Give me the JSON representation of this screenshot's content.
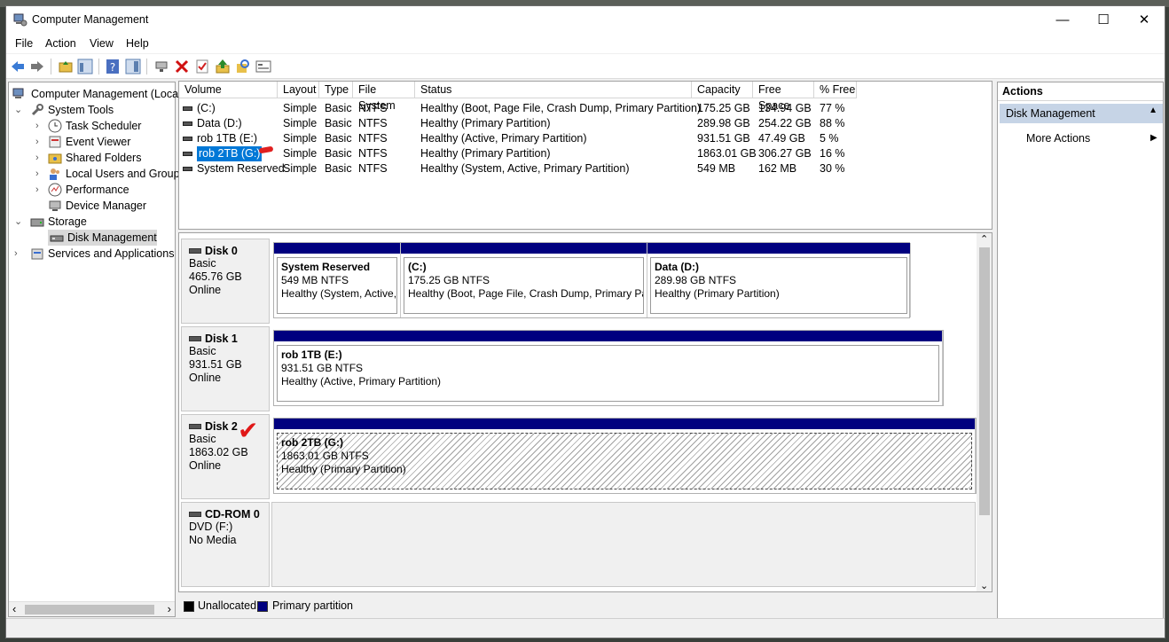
{
  "window": {
    "title": "Computer Management",
    "minimize": "—",
    "maximize": "☐",
    "close": "✕"
  },
  "menu": [
    "File",
    "Action",
    "View",
    "Help"
  ],
  "tree": {
    "root": "Computer Management (Local",
    "system_tools": "System Tools",
    "task_scheduler": "Task Scheduler",
    "event_viewer": "Event Viewer",
    "shared_folders": "Shared Folders",
    "local_users": "Local Users and Groups",
    "performance": "Performance",
    "device_manager": "Device Manager",
    "storage": "Storage",
    "disk_management": "Disk Management",
    "services": "Services and Applications"
  },
  "volume_table": {
    "headers": [
      "Volume",
      "Layout",
      "Type",
      "File System",
      "Status",
      "Capacity",
      "Free Space",
      "% Free"
    ],
    "rows": [
      [
        "(C:)",
        "Simple",
        "Basic",
        "NTFS",
        "Healthy (Boot, Page File, Crash Dump, Primary Partition)",
        "175.25 GB",
        "134.94 GB",
        "77 %"
      ],
      [
        "Data (D:)",
        "Simple",
        "Basic",
        "NTFS",
        "Healthy (Primary Partition)",
        "289.98 GB",
        "254.22 GB",
        "88 %"
      ],
      [
        "rob 1TB (E:)",
        "Simple",
        "Basic",
        "NTFS",
        "Healthy (Active, Primary Partition)",
        "931.51 GB",
        "47.49 GB",
        "5 %"
      ],
      [
        "rob 2TB (G:)",
        "Simple",
        "Basic",
        "NTFS",
        "Healthy (Primary Partition)",
        "1863.01 GB",
        "306.27 GB",
        "16 %"
      ],
      [
        "System Reserved",
        "Simple",
        "Basic",
        "NTFS",
        "Healthy (System, Active, Primary Partition)",
        "549 MB",
        "162 MB",
        "30 %"
      ]
    ],
    "selected_row": 3
  },
  "disks": [
    {
      "name": "Disk 0",
      "type": "Basic",
      "size": "465.76 GB",
      "state": "Online",
      "partitions": [
        {
          "name": "System Reserved",
          "size": "549 MB NTFS",
          "status": "Healthy (System, Active, Primary Partition)"
        },
        {
          "name": " (C:)",
          "size": "175.25 GB NTFS",
          "status": "Healthy (Boot, Page File, Crash Dump, Primary Partition)"
        },
        {
          "name": "Data  (D:)",
          "size": "289.98 GB NTFS",
          "status": "Healthy (Primary Partition)"
        }
      ]
    },
    {
      "name": "Disk 1",
      "type": "Basic",
      "size": "931.51 GB",
      "state": "Online",
      "partitions": [
        {
          "name": "rob 1TB  (E:)",
          "size": "931.51 GB NTFS",
          "status": "Healthy (Active, Primary Partition)"
        }
      ]
    },
    {
      "name": "Disk 2",
      "type": "Basic",
      "size": "1863.02 GB",
      "state": "Online",
      "partitions": [
        {
          "name": "rob 2TB  (G:)",
          "size": "1863.01 GB NTFS",
          "status": "Healthy (Primary Partition)"
        }
      ]
    },
    {
      "name": "CD-ROM 0",
      "type": "DVD (F:)",
      "size": "",
      "state": "No Media",
      "partitions": []
    }
  ],
  "legend": {
    "unallocated": "Unallocated",
    "primary": "Primary partition",
    "unallocated_color": "#000000",
    "primary_color": "#00007f"
  },
  "actions": {
    "header": "Actions",
    "section": "Disk Management",
    "more": "More Actions"
  },
  "annotation": {
    "checkmark": "✔",
    "checkmark_color": "#e01818"
  }
}
